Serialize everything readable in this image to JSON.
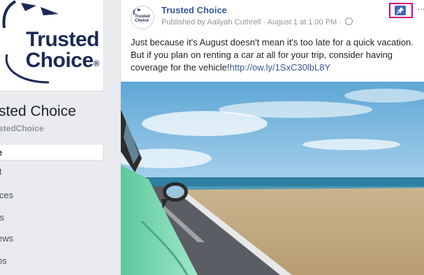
{
  "sidebar": {
    "logo_line1": "Trusted",
    "logo_line2": "Choice",
    "logo_mark": "®",
    "page_name": "sted Choice",
    "page_handle": "stedChoice",
    "nav": [
      "e",
      "it",
      "ices",
      "ts",
      "ews",
      "os"
    ]
  },
  "post": {
    "avatar_text_1": "Trusted",
    "avatar_text_2": "Choice",
    "author": "Trusted Choice",
    "published_by": "Published by Aaliyah Cuthrell",
    "date": "August 1 at 1:00 PM",
    "separator": "·",
    "text": "Just because it's August doesn't mean it's too late for a quick vacation. But if you plan on renting a car at all for your trip, consider having coverage for the vehicle!",
    "link": "http://ow.ly/1SxC30lbL8Y",
    "pin_icon": "pin-icon",
    "more_icon": "ellipsis-icon",
    "more_label": "···"
  },
  "colors": {
    "link": "#365899",
    "pin_highlight": "#e0007a",
    "pin_button": "#4267b2",
    "car": "#7ed9b3",
    "sea": "#2f7fa0",
    "sky": "#a9d3ec"
  }
}
